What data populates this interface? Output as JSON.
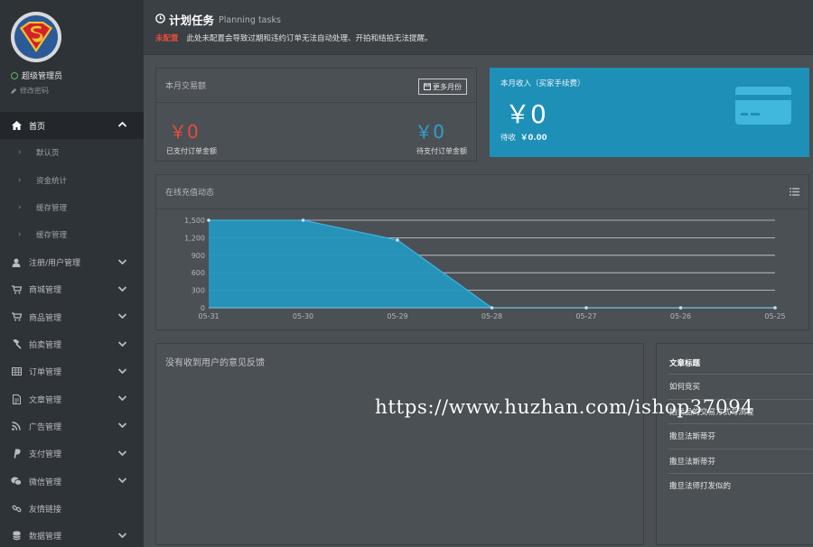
{
  "sidebar": {
    "user_name": "超级管理员",
    "change_password": "修改密码",
    "items": [
      {
        "label": "首页",
        "icon": "home-icon",
        "active": true,
        "expanded": true
      },
      {
        "label": "注册/用户管理",
        "icon": "user-icon"
      },
      {
        "label": "商城管理",
        "icon": "cart-icon"
      },
      {
        "label": "商品管理",
        "icon": "cart-icon"
      },
      {
        "label": "拍卖管理",
        "icon": "gavel-icon"
      },
      {
        "label": "订单管理",
        "icon": "table-icon"
      },
      {
        "label": "文章管理",
        "icon": "document-icon"
      },
      {
        "label": "广告管理",
        "icon": "rss-icon"
      },
      {
        "label": "支付管理",
        "icon": "paypal-icon"
      },
      {
        "label": "微信管理",
        "icon": "wechat-icon"
      },
      {
        "label": "友情链接",
        "icon": "link-icon"
      },
      {
        "label": "数据管理",
        "icon": "database-icon"
      }
    ],
    "sub_items": [
      "默认页",
      "资金统计",
      "缓存管理",
      "缓存管理"
    ]
  },
  "header": {
    "title": "计划任务",
    "subtitle": "Planning tasks",
    "warn_label": "未配置",
    "warn_text": "此处未配置会导致过期和违约订单无法自动处理、开拍和结拍无法提醒。"
  },
  "trade": {
    "title": "本月交易额",
    "more_button": "更多月份",
    "paid_value": "￥0",
    "paid_label": "已支付订单金额",
    "pending_value": "￥0",
    "pending_label": "待支付订单金额"
  },
  "income": {
    "title": "本月收入（买家手续费）",
    "value": "￥0",
    "pending_label": "待收",
    "pending_value": "￥0.00"
  },
  "chart": {
    "title": "在线充值动态"
  },
  "chart_data": {
    "type": "area",
    "categories": [
      "05-31",
      "05-30",
      "05-29",
      "05-28",
      "05-27",
      "05-26",
      "05-25"
    ],
    "values": [
      1500,
      1500,
      1160,
      0,
      0,
      0,
      0
    ],
    "yticks": [
      0,
      300,
      600,
      900,
      1200,
      1500
    ],
    "yticklabels": [
      "0",
      "300",
      "600",
      "900",
      "1,200",
      "1,500"
    ],
    "ylim": [
      0,
      1500
    ],
    "grid": true,
    "color": "#2596be"
  },
  "feedback": {
    "empty_text": "没有收到用户的意见反馈"
  },
  "articles": {
    "header": "文章标题",
    "rows": [
      "如何竞买",
      "拍卖品的交易方式与流程",
      "撒旦法斯蒂芬",
      "撒旦法斯蒂芬",
      "撒旦法师打发似的"
    ]
  },
  "watermark": "https://www.huzhan.com/ishop37094"
}
